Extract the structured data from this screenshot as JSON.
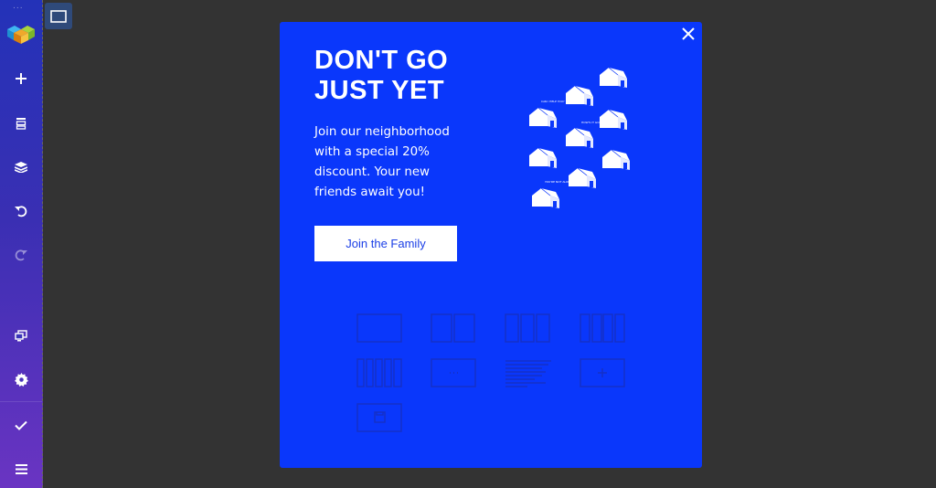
{
  "sidebar": {
    "drag_handle": "...",
    "items": [
      {
        "name": "add-element",
        "icon": "plus-icon"
      },
      {
        "name": "templates",
        "icon": "template-icon"
      },
      {
        "name": "layers",
        "icon": "layers-icon"
      },
      {
        "name": "undo",
        "icon": "undo-icon"
      },
      {
        "name": "redo",
        "icon": "redo-icon"
      },
      {
        "name": "responsive-view",
        "icon": "devices-icon"
      },
      {
        "name": "settings",
        "icon": "gear-icon"
      },
      {
        "name": "save",
        "icon": "check-icon"
      },
      {
        "name": "menu",
        "icon": "hamburger-icon"
      }
    ]
  },
  "popup": {
    "title_line1": "DON'T GO",
    "title_line2": "JUST YET",
    "body_line1": "Join our neighborhood",
    "body_line2": "with a special 20%",
    "body_line3": "discount. Your new",
    "body_line4": "friends await you!",
    "cta_label": "Join the Family",
    "illustration_captions": [
      "CAN I HELP YOU?",
      "HOW'S IT GOING?",
      "YOU'RE NOT ALONE!"
    ],
    "colors": {
      "background": "#0a37fb",
      "cta_text": "#1a3ee6"
    }
  },
  "layout_placeholders": [
    "one-column",
    "two-columns",
    "three-columns",
    "four-columns",
    "five-columns",
    "content-element",
    "text-block",
    "add-element",
    "add-image"
  ]
}
